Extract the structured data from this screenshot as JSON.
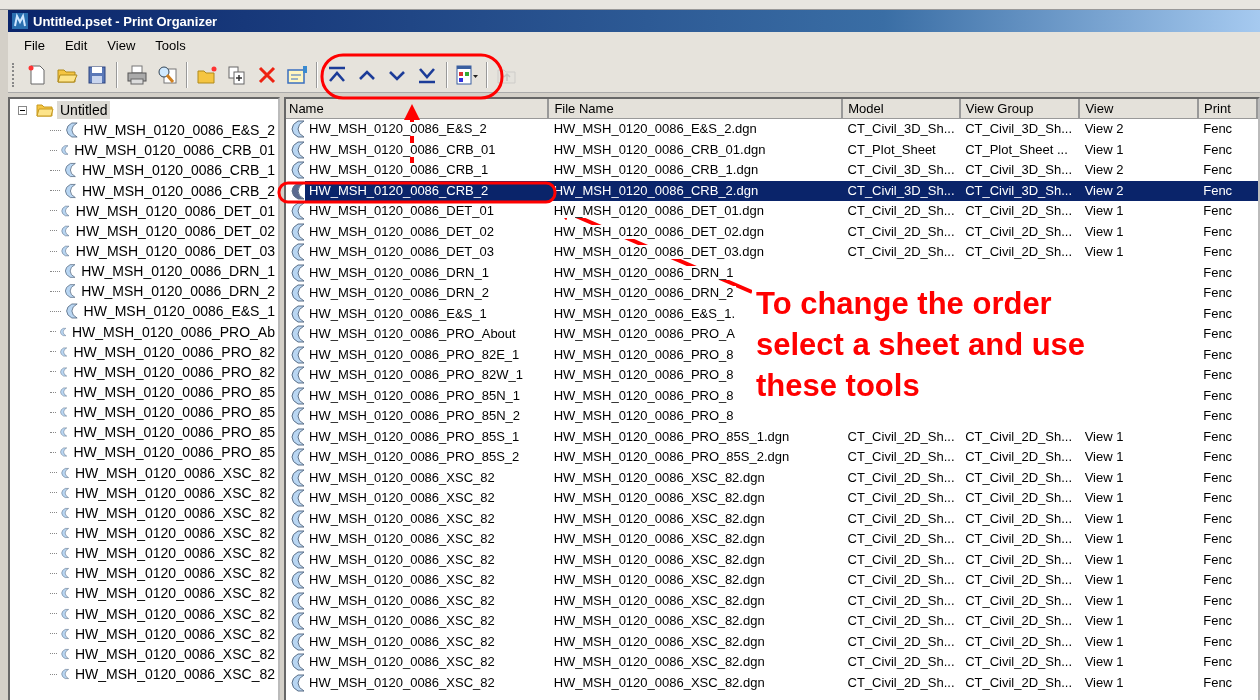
{
  "window": {
    "title": "Untitled.pset - Print Organizer"
  },
  "menu": [
    "File",
    "Edit",
    "View",
    "Tools"
  ],
  "toolbar": [
    {
      "kind": "new",
      "disabled": false
    },
    {
      "kind": "open",
      "disabled": false
    },
    {
      "kind": "save",
      "disabled": false
    },
    {
      "kind": "separator"
    },
    {
      "kind": "print",
      "disabled": false
    },
    {
      "kind": "preview",
      "disabled": false
    },
    {
      "kind": "separator"
    },
    {
      "kind": "new-folder",
      "disabled": false
    },
    {
      "kind": "copy",
      "disabled": false
    },
    {
      "kind": "delete",
      "disabled": false
    },
    {
      "kind": "properties",
      "disabled": false
    },
    {
      "kind": "separator"
    },
    {
      "kind": "top",
      "disabled": false
    },
    {
      "kind": "up",
      "disabled": false
    },
    {
      "kind": "down",
      "disabled": false
    },
    {
      "kind": "bottom",
      "disabled": false
    },
    {
      "kind": "separator"
    },
    {
      "kind": "layout",
      "disabled": false
    },
    {
      "kind": "separator"
    },
    {
      "kind": "up-folder",
      "disabled": true
    }
  ],
  "tree": {
    "label": "Untitled",
    "selected": true,
    "expanded": true,
    "children": [
      {
        "label": "HW_MSH_0120_0086_E&S_2"
      },
      {
        "label": "HW_MSH_0120_0086_CRB_01"
      },
      {
        "label": "HW_MSH_0120_0086_CRB_1"
      },
      {
        "label": "HW_MSH_0120_0086_CRB_2"
      },
      {
        "label": "HW_MSH_0120_0086_DET_01"
      },
      {
        "label": "HW_MSH_0120_0086_DET_02"
      },
      {
        "label": "HW_MSH_0120_0086_DET_03"
      },
      {
        "label": "HW_MSH_0120_0086_DRN_1"
      },
      {
        "label": "HW_MSH_0120_0086_DRN_2"
      },
      {
        "label": "HW_MSH_0120_0086_E&S_1"
      },
      {
        "label": "HW_MSH_0120_0086_PRO_Ab"
      },
      {
        "label": "HW_MSH_0120_0086_PRO_82"
      },
      {
        "label": "HW_MSH_0120_0086_PRO_82"
      },
      {
        "label": "HW_MSH_0120_0086_PRO_85"
      },
      {
        "label": "HW_MSH_0120_0086_PRO_85"
      },
      {
        "label": "HW_MSH_0120_0086_PRO_85"
      },
      {
        "label": "HW_MSH_0120_0086_PRO_85"
      },
      {
        "label": "HW_MSH_0120_0086_XSC_82"
      },
      {
        "label": "HW_MSH_0120_0086_XSC_82"
      },
      {
        "label": "HW_MSH_0120_0086_XSC_82"
      },
      {
        "label": "HW_MSH_0120_0086_XSC_82"
      },
      {
        "label": "HW_MSH_0120_0086_XSC_82"
      },
      {
        "label": "HW_MSH_0120_0086_XSC_82"
      },
      {
        "label": "HW_MSH_0120_0086_XSC_82"
      },
      {
        "label": "HW_MSH_0120_0086_XSC_82"
      },
      {
        "label": "HW_MSH_0120_0086_XSC_82"
      },
      {
        "label": "HW_MSH_0120_0086_XSC_82"
      },
      {
        "label": "HW_MSH_0120_0086_XSC_82"
      }
    ]
  },
  "table": {
    "columns": [
      "Name",
      "File Name",
      "Model",
      "View Group",
      "View",
      "Print"
    ],
    "rows": [
      {
        "name": "HW_MSH_0120_0086_E&S_2",
        "file": "HW_MSH_0120_0086_E&S_2.dgn",
        "model": "CT_Civil_3D_Sh...",
        "view_group": "CT_Civil_3D_Sh...",
        "view": "View 2",
        "print": "Fenc",
        "selected": false
      },
      {
        "name": "HW_MSH_0120_0086_CRB_01",
        "file": "HW_MSH_0120_0086_CRB_01.dgn",
        "model": "CT_Plot_Sheet",
        "view_group": "CT_Plot_Sheet ...",
        "view": "View 1",
        "print": "Fenc",
        "selected": false
      },
      {
        "name": "HW_MSH_0120_0086_CRB_1",
        "file": "HW_MSH_0120_0086_CRB_1.dgn",
        "model": "CT_Civil_3D_Sh...",
        "view_group": "CT_Civil_3D_Sh...",
        "view": "View 2",
        "print": "Fenc",
        "selected": false
      },
      {
        "name": "HW_MSH_0120_0086_CRB_2",
        "file": "HW_MSH_0120_0086_CRB_2.dgn",
        "model": "CT_Civil_3D_Sh...",
        "view_group": "CT_Civil_3D_Sh...",
        "view": "View 2",
        "print": "Fenc",
        "selected": true
      },
      {
        "name": "HW_MSH_0120_0086_DET_01",
        "file": "HW_MSH_0120_0086_DET_01.dgn",
        "model": "CT_Civil_2D_Sh...",
        "view_group": "CT_Civil_2D_Sh...",
        "view": "View 1",
        "print": "Fenc",
        "selected": false
      },
      {
        "name": "HW_MSH_0120_0086_DET_02",
        "file": "HW_MSH_0120_0086_DET_02.dgn",
        "model": "CT_Civil_2D_Sh...",
        "view_group": "CT_Civil_2D_Sh...",
        "view": "View 1",
        "print": "Fenc",
        "selected": false
      },
      {
        "name": "HW_MSH_0120_0086_DET_03",
        "file": "HW_MSH_0120_0086_DET_03.dgn",
        "model": "CT_Civil_2D_Sh...",
        "view_group": "CT_Civil_2D_Sh...",
        "view": "View 1",
        "print": "Fenc",
        "selected": false
      },
      {
        "name": "HW_MSH_0120_0086_DRN_1",
        "file": "HW_MSH_0120_0086_DRN_1",
        "print": "Fenc",
        "selected": false
      },
      {
        "name": "HW_MSH_0120_0086_DRN_2",
        "file": "HW_MSH_0120_0086_DRN_2",
        "print": "Fenc",
        "selected": false
      },
      {
        "name": "HW_MSH_0120_0086_E&S_1",
        "file": "HW_MSH_0120_0086_E&S_1.",
        "print": "Fenc",
        "selected": false
      },
      {
        "name": "HW_MSH_0120_0086_PRO_About",
        "file": "HW_MSH_0120_0086_PRO_A",
        "print": "Fenc",
        "selected": false
      },
      {
        "name": "HW_MSH_0120_0086_PRO_82E_1",
        "file": "HW_MSH_0120_0086_PRO_8",
        "print": "Fenc",
        "selected": false
      },
      {
        "name": "HW_MSH_0120_0086_PRO_82W_1",
        "file": "HW_MSH_0120_0086_PRO_8",
        "print": "Fenc",
        "selected": false
      },
      {
        "name": "HW_MSH_0120_0086_PRO_85N_1",
        "file": "HW_MSH_0120_0086_PRO_8",
        "print": "Fenc",
        "selected": false
      },
      {
        "name": "HW_MSH_0120_0086_PRO_85N_2",
        "file": "HW_MSH_0120_0086_PRO_8",
        "print": "Fenc",
        "selected": false
      },
      {
        "name": "HW_MSH_0120_0086_PRO_85S_1",
        "file": "HW_MSH_0120_0086_PRO_85S_1.dgn",
        "model": "CT_Civil_2D_Sh...",
        "view_group": "CT_Civil_2D_Sh...",
        "view": "View 1",
        "print": "Fenc",
        "selected": false
      },
      {
        "name": "HW_MSH_0120_0086_PRO_85S_2",
        "file": "HW_MSH_0120_0086_PRO_85S_2.dgn",
        "model": "CT_Civil_2D_Sh...",
        "view_group": "CT_Civil_2D_Sh...",
        "view": "View 1",
        "print": "Fenc",
        "selected": false
      },
      {
        "name": "HW_MSH_0120_0086_XSC_82",
        "file": "HW_MSH_0120_0086_XSC_82.dgn",
        "model": "CT_Civil_2D_Sh...",
        "view_group": "CT_Civil_2D_Sh...",
        "view": "View 1",
        "print": "Fenc",
        "selected": false
      },
      {
        "name": "HW_MSH_0120_0086_XSC_82",
        "file": "HW_MSH_0120_0086_XSC_82.dgn",
        "model": "CT_Civil_2D_Sh...",
        "view_group": "CT_Civil_2D_Sh...",
        "view": "View 1",
        "print": "Fenc",
        "selected": false
      },
      {
        "name": "HW_MSH_0120_0086_XSC_82",
        "file": "HW_MSH_0120_0086_XSC_82.dgn",
        "model": "CT_Civil_2D_Sh...",
        "view_group": "CT_Civil_2D_Sh...",
        "view": "View 1",
        "print": "Fenc",
        "selected": false
      },
      {
        "name": "HW_MSH_0120_0086_XSC_82",
        "file": "HW_MSH_0120_0086_XSC_82.dgn",
        "model": "CT_Civil_2D_Sh...",
        "view_group": "CT_Civil_2D_Sh...",
        "view": "View 1",
        "print": "Fenc",
        "selected": false
      },
      {
        "name": "HW_MSH_0120_0086_XSC_82",
        "file": "HW_MSH_0120_0086_XSC_82.dgn",
        "model": "CT_Civil_2D_Sh...",
        "view_group": "CT_Civil_2D_Sh...",
        "view": "View 1",
        "print": "Fenc",
        "selected": false
      },
      {
        "name": "HW_MSH_0120_0086_XSC_82",
        "file": "HW_MSH_0120_0086_XSC_82.dgn",
        "model": "CT_Civil_2D_Sh...",
        "view_group": "CT_Civil_2D_Sh...",
        "view": "View 1",
        "print": "Fenc",
        "selected": false
      },
      {
        "name": "HW_MSH_0120_0086_XSC_82",
        "file": "HW_MSH_0120_0086_XSC_82.dgn",
        "model": "CT_Civil_2D_Sh...",
        "view_group": "CT_Civil_2D_Sh...",
        "view": "View 1",
        "print": "Fenc",
        "selected": false
      },
      {
        "name": "HW_MSH_0120_0086_XSC_82",
        "file": "HW_MSH_0120_0086_XSC_82.dgn",
        "model": "CT_Civil_2D_Sh...",
        "view_group": "CT_Civil_2D_Sh...",
        "view": "View 1",
        "print": "Fenc",
        "selected": false
      },
      {
        "name": "HW_MSH_0120_0086_XSC_82",
        "file": "HW_MSH_0120_0086_XSC_82.dgn",
        "model": "CT_Civil_2D_Sh...",
        "view_group": "CT_Civil_2D_Sh...",
        "view": "View 1",
        "print": "Fenc",
        "selected": false
      },
      {
        "name": "HW_MSH_0120_0086_XSC_82",
        "file": "HW_MSH_0120_0086_XSC_82.dgn",
        "model": "CT_Civil_2D_Sh...",
        "view_group": "CT_Civil_2D_Sh...",
        "view": "View 1",
        "print": "Fenc",
        "selected": false
      },
      {
        "name": "HW_MSH_0120_0086_XSC_82",
        "file": "HW_MSH_0120_0086_XSC_82.dgn",
        "model": "CT_Civil_2D_Sh...",
        "view_group": "CT_Civil_2D_Sh...",
        "view": "View 1",
        "print": "Fenc",
        "selected": false
      }
    ]
  },
  "annotation": {
    "lines": [
      "To change the order",
      "select a sheet and use",
      "these tools"
    ]
  }
}
